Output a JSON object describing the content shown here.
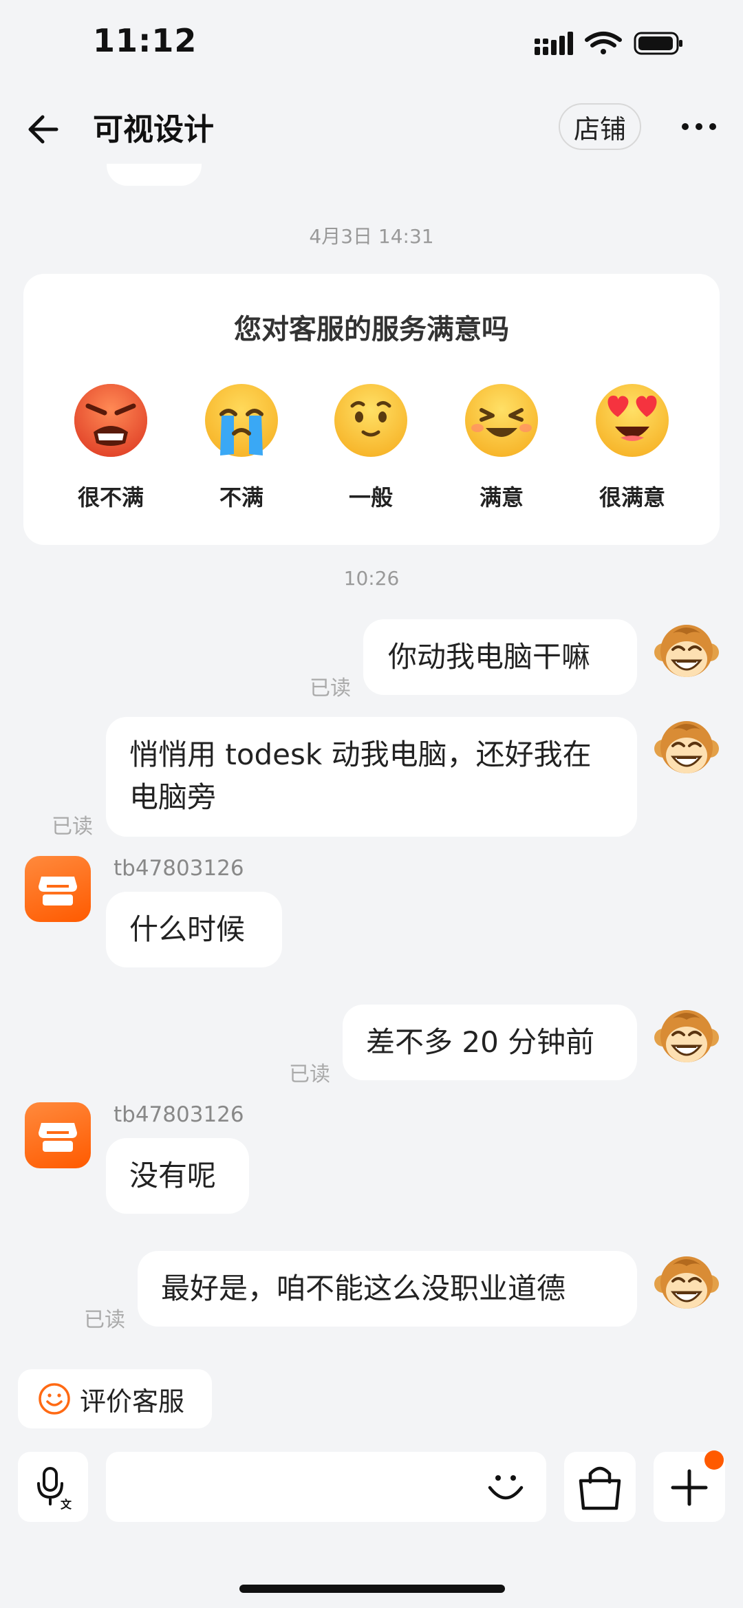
{
  "status": {
    "time": "11:12"
  },
  "header": {
    "title": "可视设计",
    "shop_label": "店铺"
  },
  "timestamps": {
    "first": "4月3日 14:31",
    "second": "10:26"
  },
  "rating_card": {
    "question": "您对客服的服务满意吗",
    "options": [
      {
        "label": "很不满",
        "icon": "very-angry-face-icon"
      },
      {
        "label": "不满",
        "icon": "crying-face-icon"
      },
      {
        "label": "一般",
        "icon": "neutral-face-icon"
      },
      {
        "label": "满意",
        "icon": "happy-face-icon"
      },
      {
        "label": "很满意",
        "icon": "heart-eyes-face-icon"
      }
    ]
  },
  "messages": [
    {
      "side": "right",
      "text": "你动我电脑干嘛",
      "read": "已读"
    },
    {
      "side": "right",
      "text": "悄悄用 todesk 动我电脑，还好我在电脑旁",
      "read": "已读"
    },
    {
      "side": "left",
      "sender": "tb47803126",
      "text": "什么时候"
    },
    {
      "side": "right",
      "text": "差不多 20 分钟前",
      "read": "已读"
    },
    {
      "side": "left",
      "sender": "tb47803126",
      "text": "没有呢"
    },
    {
      "side": "right",
      "text": "最好是，咱不能这么没职业道德",
      "read": "已读"
    }
  ],
  "bottom": {
    "rate_service_label": "评价客服",
    "input_placeholder": "",
    "icons": [
      "voice-translate-icon",
      "emoji-icon",
      "shopping-bag-icon",
      "plus-icon"
    ]
  },
  "colors": {
    "accent": "#ff5a00",
    "background": "#f3f4f6",
    "bubble": "#ffffff"
  }
}
